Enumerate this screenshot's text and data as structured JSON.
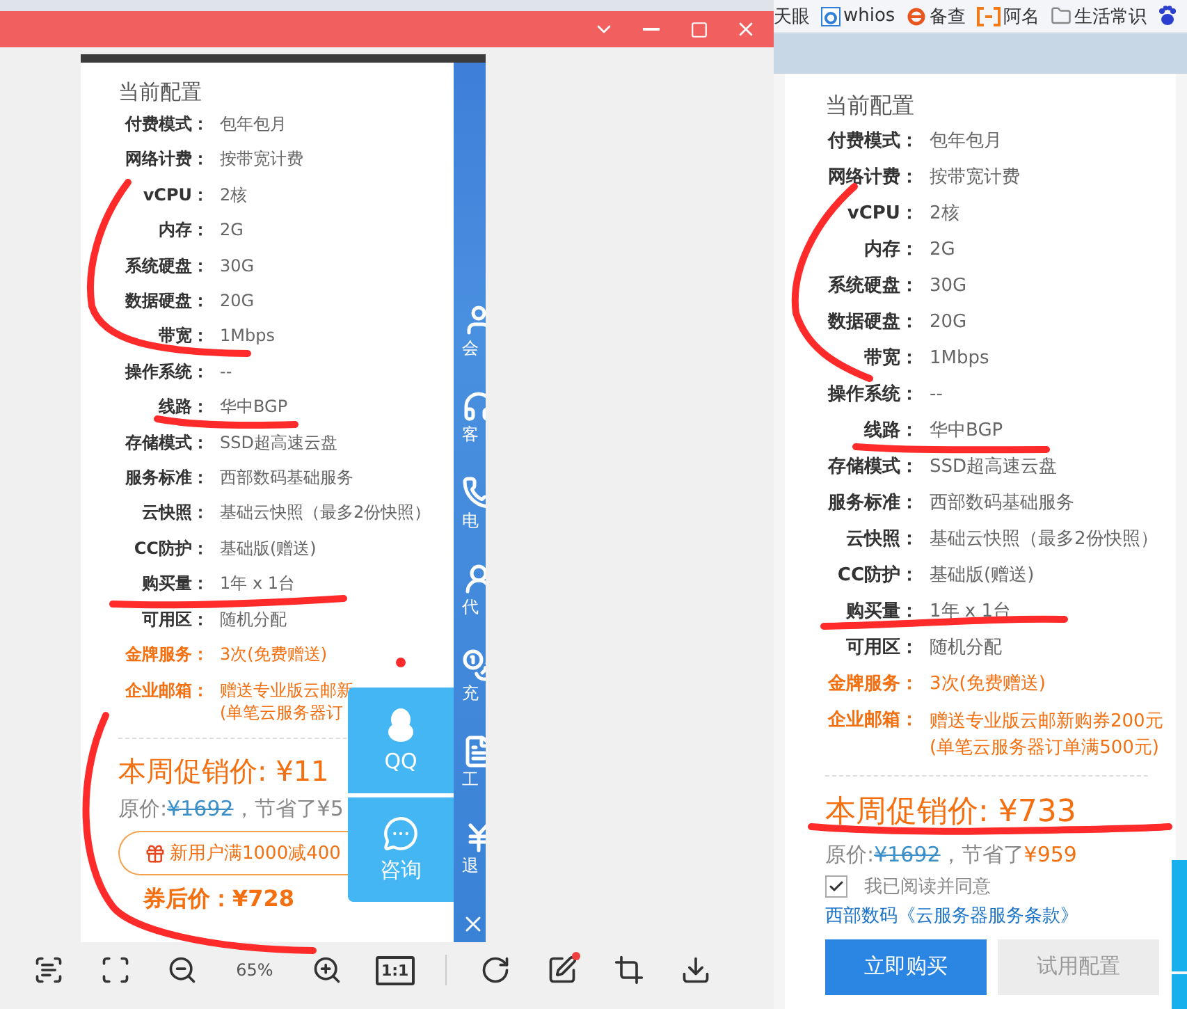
{
  "browser": {
    "bookmarks": [
      {
        "kind": "plain",
        "label": "天眼"
      },
      {
        "kind": "a-logo",
        "label": "whios"
      },
      {
        "kind": "e-logo",
        "label": "备查"
      },
      {
        "kind": "bracket-logo",
        "label": "阿名"
      },
      {
        "kind": "folder",
        "label": "生活常识"
      },
      {
        "kind": "paw"
      }
    ]
  },
  "viewer": {
    "image": {
      "title": "当前配置",
      "specs": [
        {
          "label": "付费模式：",
          "value": [
            "包年包月"
          ],
          "highlight": false
        },
        {
          "label": "网络计费：",
          "value": [
            "按带宽计费"
          ],
          "highlight": false
        },
        {
          "label": "vCPU：",
          "value": [
            "2核"
          ],
          "highlight": false
        },
        {
          "label": "内存：",
          "value": [
            "2G"
          ],
          "highlight": false
        },
        {
          "label": "系统硬盘：",
          "value": [
            "30G"
          ],
          "highlight": false
        },
        {
          "label": "数据硬盘：",
          "value": [
            "20G"
          ],
          "highlight": false
        },
        {
          "label": "带宽：",
          "value": [
            "1Mbps"
          ],
          "highlight": false
        },
        {
          "label": "操作系统：",
          "value": [
            "--"
          ],
          "highlight": false
        },
        {
          "label": "线路：",
          "value": [
            "华中BGP"
          ],
          "highlight": false
        },
        {
          "label": "存储模式：",
          "value": [
            "SSD超高速云盘"
          ],
          "highlight": false
        },
        {
          "label": "服务标准：",
          "value": [
            "西部数码基础服务"
          ],
          "highlight": false
        },
        {
          "label": "云快照：",
          "value": [
            "基础云快照（最多2份快照）"
          ],
          "highlight": false
        },
        {
          "label": "CC防护：",
          "value": [
            "基础版(赠送)"
          ],
          "highlight": false
        },
        {
          "label": "购买量：",
          "value": [
            "1年 x 1台"
          ],
          "highlight": false
        },
        {
          "label": "可用区：",
          "value": [
            "随机分配"
          ],
          "highlight": false
        },
        {
          "label": "金牌服务：",
          "value": [
            "3次(免费赠送)"
          ],
          "highlight": true
        },
        {
          "label": "企业邮箱：",
          "value": [
            "赠送专业版云邮新",
            "(单笔云服务器订"
          ],
          "highlight": true
        }
      ],
      "price": "本周促销价: ¥11",
      "original_label": "原价:",
      "original_price": "¥1692",
      "saving": "，节省了¥5",
      "coupon": "新用户满1000减400",
      "final_price": "券后价：¥728",
      "sidebar": [
        {
          "kind": "member",
          "label": "会"
        },
        {
          "kind": "service",
          "label": "客"
        },
        {
          "kind": "phone",
          "label": "电"
        },
        {
          "kind": "agent",
          "label": "代"
        },
        {
          "kind": "recharge",
          "label": "充"
        },
        {
          "kind": "ticket",
          "label": "工"
        },
        {
          "kind": "refund",
          "label": "退"
        },
        {
          "kind": "close"
        }
      ],
      "float_buttons": [
        {
          "kind": "qq",
          "label": "QQ"
        },
        {
          "kind": "chat",
          "label": "咨询"
        }
      ]
    },
    "toolbar": {
      "zoom": "65%",
      "actual_size": "1:1"
    }
  },
  "page": {
    "title": "当前配置",
    "specs": [
      {
        "label": "付费模式：",
        "value": [
          "包年包月"
        ],
        "highlight": false
      },
      {
        "label": "网络计费：",
        "value": [
          "按带宽计费"
        ],
        "highlight": false
      },
      {
        "label": "vCPU：",
        "value": [
          "2核"
        ],
        "highlight": false
      },
      {
        "label": "内存：",
        "value": [
          "2G"
        ],
        "highlight": false
      },
      {
        "label": "系统硬盘：",
        "value": [
          "30G"
        ],
        "highlight": false
      },
      {
        "label": "数据硬盘：",
        "value": [
          "20G"
        ],
        "highlight": false
      },
      {
        "label": "带宽：",
        "value": [
          "1Mbps"
        ],
        "highlight": false
      },
      {
        "label": "操作系统：",
        "value": [
          "--"
        ],
        "highlight": false
      },
      {
        "label": "线路：",
        "value": [
          "华中BGP"
        ],
        "highlight": false
      },
      {
        "label": "存储模式：",
        "value": [
          "SSD超高速云盘"
        ],
        "highlight": false
      },
      {
        "label": "服务标准：",
        "value": [
          "西部数码基础服务"
        ],
        "highlight": false
      },
      {
        "label": "云快照：",
        "value": [
          "基础云快照（最多2份快照）"
        ],
        "highlight": false
      },
      {
        "label": "CC防护：",
        "value": [
          "基础版(赠送)"
        ],
        "highlight": false
      },
      {
        "label": "购买量：",
        "value": [
          "1年 x 1台"
        ],
        "highlight": false
      },
      {
        "label": "可用区：",
        "value": [
          "随机分配"
        ],
        "highlight": false
      },
      {
        "label": "金牌服务：",
        "value": [
          "3次(免费赠送)"
        ],
        "highlight": true
      },
      {
        "label": "企业邮箱：",
        "value": [
          "赠送专业版云邮新购券200元",
          "(单笔云服务器订单满500元)"
        ],
        "highlight": true
      }
    ],
    "price": "本周促销价: ¥733",
    "original_label": "原价:",
    "original_price": "¥1692",
    "saving": "，节省了",
    "saving_amount": "¥959",
    "agree": {
      "checked": true,
      "label": "我已阅读并同意"
    },
    "terms_link": "西部数码《云服务器服务条款》",
    "buttons": [
      {
        "kind": "primary",
        "label": "立即购买"
      },
      {
        "kind": "secondary",
        "label": "试用配置"
      }
    ]
  }
}
